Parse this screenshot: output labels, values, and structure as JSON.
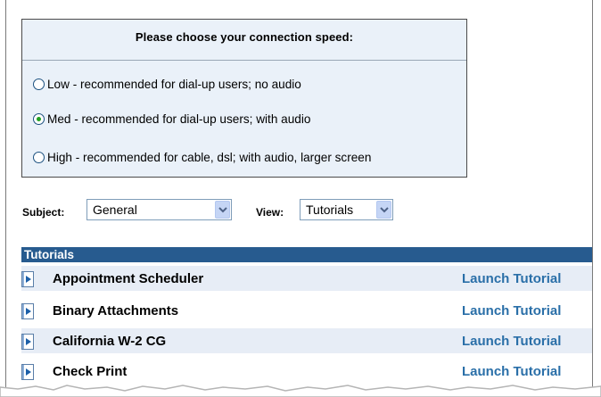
{
  "speed_panel": {
    "title": "Please choose your connection speed:",
    "options": [
      {
        "label": "Low - recommended for dial-up users; no audio",
        "selected": false
      },
      {
        "label": "Med - recommended for dial-up users; with audio",
        "selected": true
      },
      {
        "label": "High - recommended for cable, dsl; with audio, larger screen",
        "selected": false
      }
    ]
  },
  "filters": {
    "subject_label": "Subject:",
    "subject_value": "General",
    "view_label": "View:",
    "view_value": "Tutorials"
  },
  "tutorials": {
    "header": "Tutorials",
    "rows": [
      {
        "name": "Appointment Scheduler",
        "action": "Launch Tutorial"
      },
      {
        "name": "Binary Attachments",
        "action": "Launch Tutorial"
      },
      {
        "name": "California W-2 CG",
        "action": "Launch Tutorial"
      },
      {
        "name": "Check Print",
        "action": "Launch Tutorial"
      }
    ]
  },
  "colors": {
    "panel_bg": "#eaf1f9",
    "header_bg": "#275b8f",
    "row_alt_bg": "#e7edf6",
    "link": "#2a6fa8",
    "radio_selected": "#21a121"
  },
  "icons": {
    "row_icon": "video-play-icon",
    "dropdown": "chevron-down-icon"
  }
}
